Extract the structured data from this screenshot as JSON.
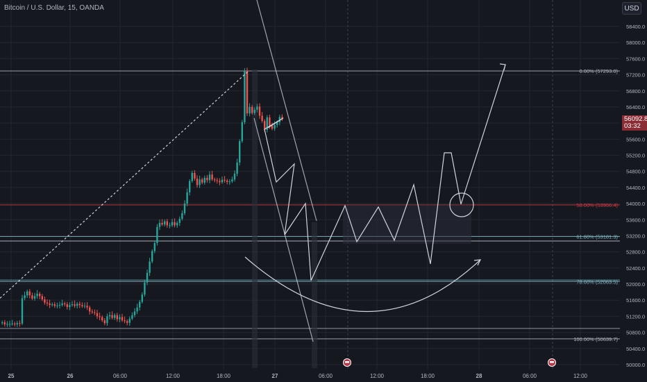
{
  "header": {
    "title": "Bitcoin / U.S. Dollar, 15, OANDA",
    "currency_label": "USD"
  },
  "price_tag": {
    "price": "56092.8",
    "countdown": "03:32"
  },
  "chart_data": {
    "type": "candlestick",
    "y_axis": {
      "ylim": [
        49800,
        58800
      ],
      "ticks": [
        50000,
        50400,
        50800,
        51200,
        51600,
        52000,
        52400,
        52800,
        53200,
        53600,
        54000,
        54400,
        54800,
        55200,
        55600,
        56000,
        56400,
        56800,
        57200,
        57600,
        58000,
        58400
      ],
      "tick_labels": [
        "50000.0",
        "50400.0",
        "50800.0",
        "51200.0",
        "51600.0",
        "52000.0",
        "52400.0",
        "52800.0",
        "53200.0",
        "53600.0",
        "54000.0",
        "54400.0",
        "54800.0",
        "55200.0",
        "55600.0",
        "56000.0",
        "56400.0",
        "56800.0",
        "57200.0",
        "57600.0",
        "58000.0",
        "58400.0"
      ]
    },
    "x_axis": {
      "tick_labels": [
        "25",
        "26",
        "06:00",
        "12:00",
        "18:00",
        "27",
        "06:00",
        "12:00",
        "18:00",
        "28",
        "06:00",
        "12:00"
      ],
      "tick_bold": [
        true,
        true,
        false,
        false,
        false,
        true,
        false,
        false,
        false,
        true,
        false,
        false
      ]
    },
    "close_series": [
      51050,
      51000,
      51010,
      51010,
      51020,
      51000,
      51030,
      51020,
      51650,
      51720,
      51820,
      51720,
      51640,
      51700,
      51760,
      51700,
      51620,
      51540,
      51520,
      51480,
      51500,
      51460,
      51470,
      51480,
      51520,
      51500,
      51430,
      51480,
      51500,
      51460,
      51510,
      51480,
      51450,
      51460,
      51420,
      51320,
      51300,
      51280,
      51200,
      51180,
      51100,
      51030,
      51200,
      51230,
      51160,
      51230,
      51130,
      51180,
      51100,
      51080,
      51040,
      51140,
      51230,
      51320,
      51420,
      51560,
      51740,
      52040,
      52280,
      52560,
      52820,
      53020,
      53420,
      53520,
      53480,
      53560,
      53460,
      53460,
      53540,
      53460,
      53520,
      53620,
      53760,
      54000,
      54280,
      54560,
      54760,
      54620,
      54460,
      54600,
      54520,
      54640,
      54580,
      54720,
      54600,
      54580,
      54560,
      54530,
      54590,
      54570,
      54540,
      54550,
      54600,
      54740,
      55020,
      55550,
      56020,
      57293,
      56240,
      56400,
      56250,
      56330,
      56410,
      56180,
      56050,
      55830,
      56140,
      55930,
      55860,
      55950,
      56020,
      56150,
      56092.8
    ],
    "fib_levels": [
      {
        "ratio_label": "0.00%",
        "price": 57293.0,
        "label": "0.00% (57293.0)",
        "color": "#b2b5be"
      },
      {
        "ratio_label": "50.00%",
        "price": 53966.4,
        "label": "50.00% (53966.4)",
        "color": "#d13a43"
      },
      {
        "ratio_label": "61.80%",
        "price": 53181.3,
        "label": "61.80% (53181.3)",
        "color": "#7fb8c4"
      },
      {
        "ratio_label": "78.60%",
        "price": 52063.5,
        "label": "78.60% (52063.5)",
        "color": "#7fb8c4"
      },
      {
        "ratio_label": "100.00%",
        "price": 50639.7,
        "label": "100.00% (50639.7)",
        "color": "#b2b5be"
      }
    ],
    "extra_levels": [
      53070,
      52100,
      50900
    ],
    "current_price": 56092.8,
    "colors": {
      "up": "#26a69a",
      "down": "#ef5350",
      "background": "#16181f",
      "grid": "#232630",
      "drawing": "#d1d4dc"
    }
  }
}
